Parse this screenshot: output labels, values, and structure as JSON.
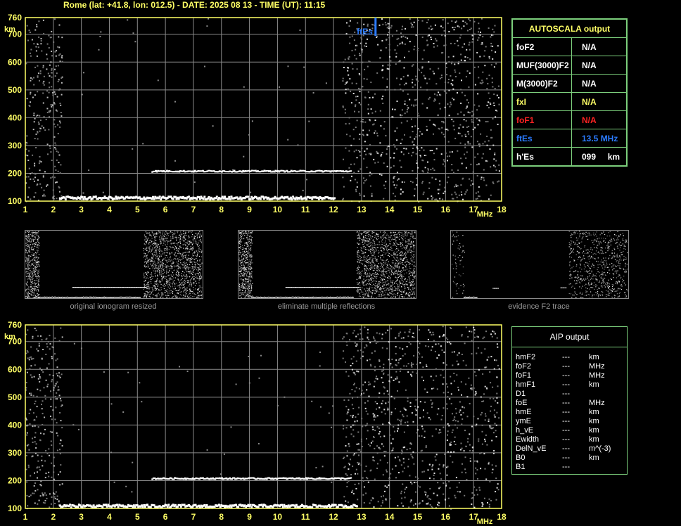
{
  "header": {
    "title": "Rome (lat: +41.8, lon: 012.5) - DATE: 2025 08 13 - TIME (UT): 11:15"
  },
  "colors": {
    "axis_yellow": "#ffff66",
    "panel_border": "#7ccf7c",
    "grid": "#8a8a8a",
    "foF1_red": "#ff2222",
    "ftEs_blue": "#2b7bff"
  },
  "chart_data": [
    {
      "type": "scatter",
      "title": "",
      "xlabel": "MHz",
      "ylabel": "km",
      "xlim": [
        1,
        18
      ],
      "ylim": [
        100,
        760
      ],
      "x_ticks": [
        1,
        2,
        3,
        4,
        5,
        6,
        7,
        8,
        9,
        10,
        11,
        12,
        13,
        14,
        15,
        16,
        17,
        18
      ],
      "y_ticks": [
        100,
        200,
        300,
        400,
        500,
        600,
        700,
        760
      ],
      "grid": true,
      "traces": [
        {
          "name": "E/Es trace",
          "x_range": [
            2.2,
            12.0
          ],
          "height_km": 115
        },
        {
          "name": "second-hop trace",
          "x_range": [
            5.5,
            12.6
          ],
          "height_km": 210
        }
      ],
      "marker": {
        "label": "ftEs",
        "x": 13.5
      }
    },
    {
      "type": "scatter",
      "title": "",
      "xlabel": "MHz",
      "ylabel": "km",
      "xlim": [
        1,
        18
      ],
      "ylim": [
        100,
        760
      ],
      "x_ticks": [
        1,
        2,
        3,
        4,
        5,
        6,
        7,
        8,
        9,
        10,
        11,
        12,
        13,
        14,
        15,
        16,
        17,
        18
      ],
      "y_ticks": [
        100,
        200,
        300,
        400,
        500,
        600,
        700,
        760
      ],
      "grid": true,
      "traces": [
        {
          "name": "E/Es trace",
          "x_range": [
            2.2,
            12.8
          ],
          "height_km": 112
        },
        {
          "name": "second-hop trace",
          "x_range": [
            5.5,
            12.6
          ],
          "height_km": 210
        }
      ]
    }
  ],
  "autoscala": {
    "title": "AUTOSCALA output",
    "rows": [
      {
        "label": "foF2",
        "value": "N/A",
        "color": "#ffffff"
      },
      {
        "label": "MUF(3000)F2",
        "value": "N/A",
        "color": "#ffffff"
      },
      {
        "label": "M(3000)F2",
        "value": "N/A",
        "color": "#ffffff"
      },
      {
        "label": "fxI",
        "value": "N/A",
        "color": "#ffff66"
      },
      {
        "label": "foF1",
        "value": "N/A",
        "color": "#ff2222"
      },
      {
        "label": "ftEs",
        "value": "13.5 MHz",
        "color": "#2b7bff"
      },
      {
        "label": "h'Es",
        "value": "099     km",
        "color": "#ffffff"
      }
    ]
  },
  "thumbnails": [
    {
      "caption": "original ionogram resized"
    },
    {
      "caption": "eliminate multiple reflections"
    },
    {
      "caption": "evidence F2 trace"
    }
  ],
  "aip": {
    "title": "AIP output",
    "rows": [
      {
        "label": "hmF2",
        "value": "---",
        "unit": "km"
      },
      {
        "label": "foF2",
        "value": "---",
        "unit": "MHz"
      },
      {
        "label": "foF1",
        "value": "---",
        "unit": "MHz"
      },
      {
        "label": "hmF1",
        "value": "---",
        "unit": "km"
      },
      {
        "label": "D1",
        "value": "---",
        "unit": ""
      },
      {
        "label": "foE",
        "value": "---",
        "unit": "MHz"
      },
      {
        "label": "hmE",
        "value": "---",
        "unit": "km"
      },
      {
        "label": "ymE",
        "value": "---",
        "unit": "km"
      },
      {
        "label": "h_vE",
        "value": "---",
        "unit": "km"
      },
      {
        "label": "Ewidth",
        "value": "---",
        "unit": "km"
      },
      {
        "label": "DelN_vE",
        "value": "---",
        "unit": "m^(-3)"
      },
      {
        "label": "B0",
        "value": "---",
        "unit": "km"
      },
      {
        "label": "B1",
        "value": "---",
        "unit": ""
      }
    ]
  }
}
